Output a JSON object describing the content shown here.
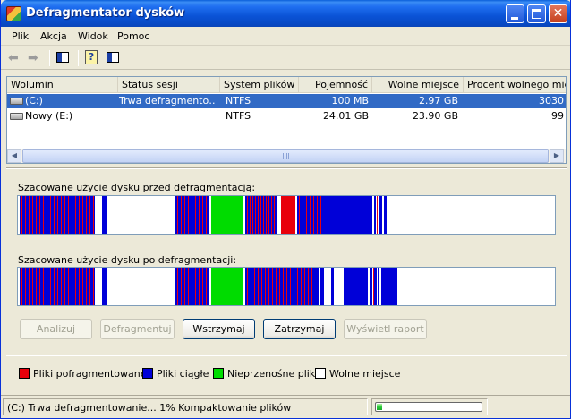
{
  "window": {
    "title": "Defragmentator dysków"
  },
  "menu": {
    "items": [
      "Plik",
      "Akcja",
      "Widok",
      "Pomoc"
    ]
  },
  "toolbar": {
    "buttons": [
      "back-icon",
      "forward-icon",
      "console-tree-icon",
      "help-icon",
      "properties-icon"
    ]
  },
  "volumes": {
    "columns": [
      "Wolumin",
      "Status sesji",
      "System plików",
      "Pojemność",
      "Wolne miejsce",
      "Procent wolnego miejs"
    ],
    "rows": [
      {
        "volume": "(C:)",
        "status": "Trwa defragmento…",
        "fs": "NTFS",
        "capacity": "100 MB",
        "free": "2.97 GB",
        "percent": "3030"
      },
      {
        "volume": "Nowy (E:)",
        "status": "",
        "fs": "NTFS",
        "capacity": "24.01 GB",
        "free": "23.90 GB",
        "percent": "99"
      }
    ]
  },
  "analysis": {
    "before_label": "Szacowane użycie dysku przed defragmentacją:",
    "after_label": "Szacowane użycie dysku po defragmentacji:"
  },
  "buttons": {
    "analyze": "Analizuj",
    "defragment": "Defragmentuj",
    "pause": "Wstrzymaj",
    "stop": "Zatrzymaj",
    "report": "Wyświetl raport"
  },
  "legend": {
    "fragmented": "Pliki pofragmentowane",
    "contiguous": "Pliki ciągłe",
    "unmovable": "Nieprzenośne pliki",
    "free": "Wolne miejsce"
  },
  "colors": {
    "fragmented": "#e8000b",
    "contiguous": "#0000d8",
    "unmovable": "#00dc00",
    "free": "#ffffff"
  },
  "status": {
    "text": "(C:) Trwa defragmentowanie... 1%  Kompaktowanie plików",
    "progress_percent": 1
  }
}
